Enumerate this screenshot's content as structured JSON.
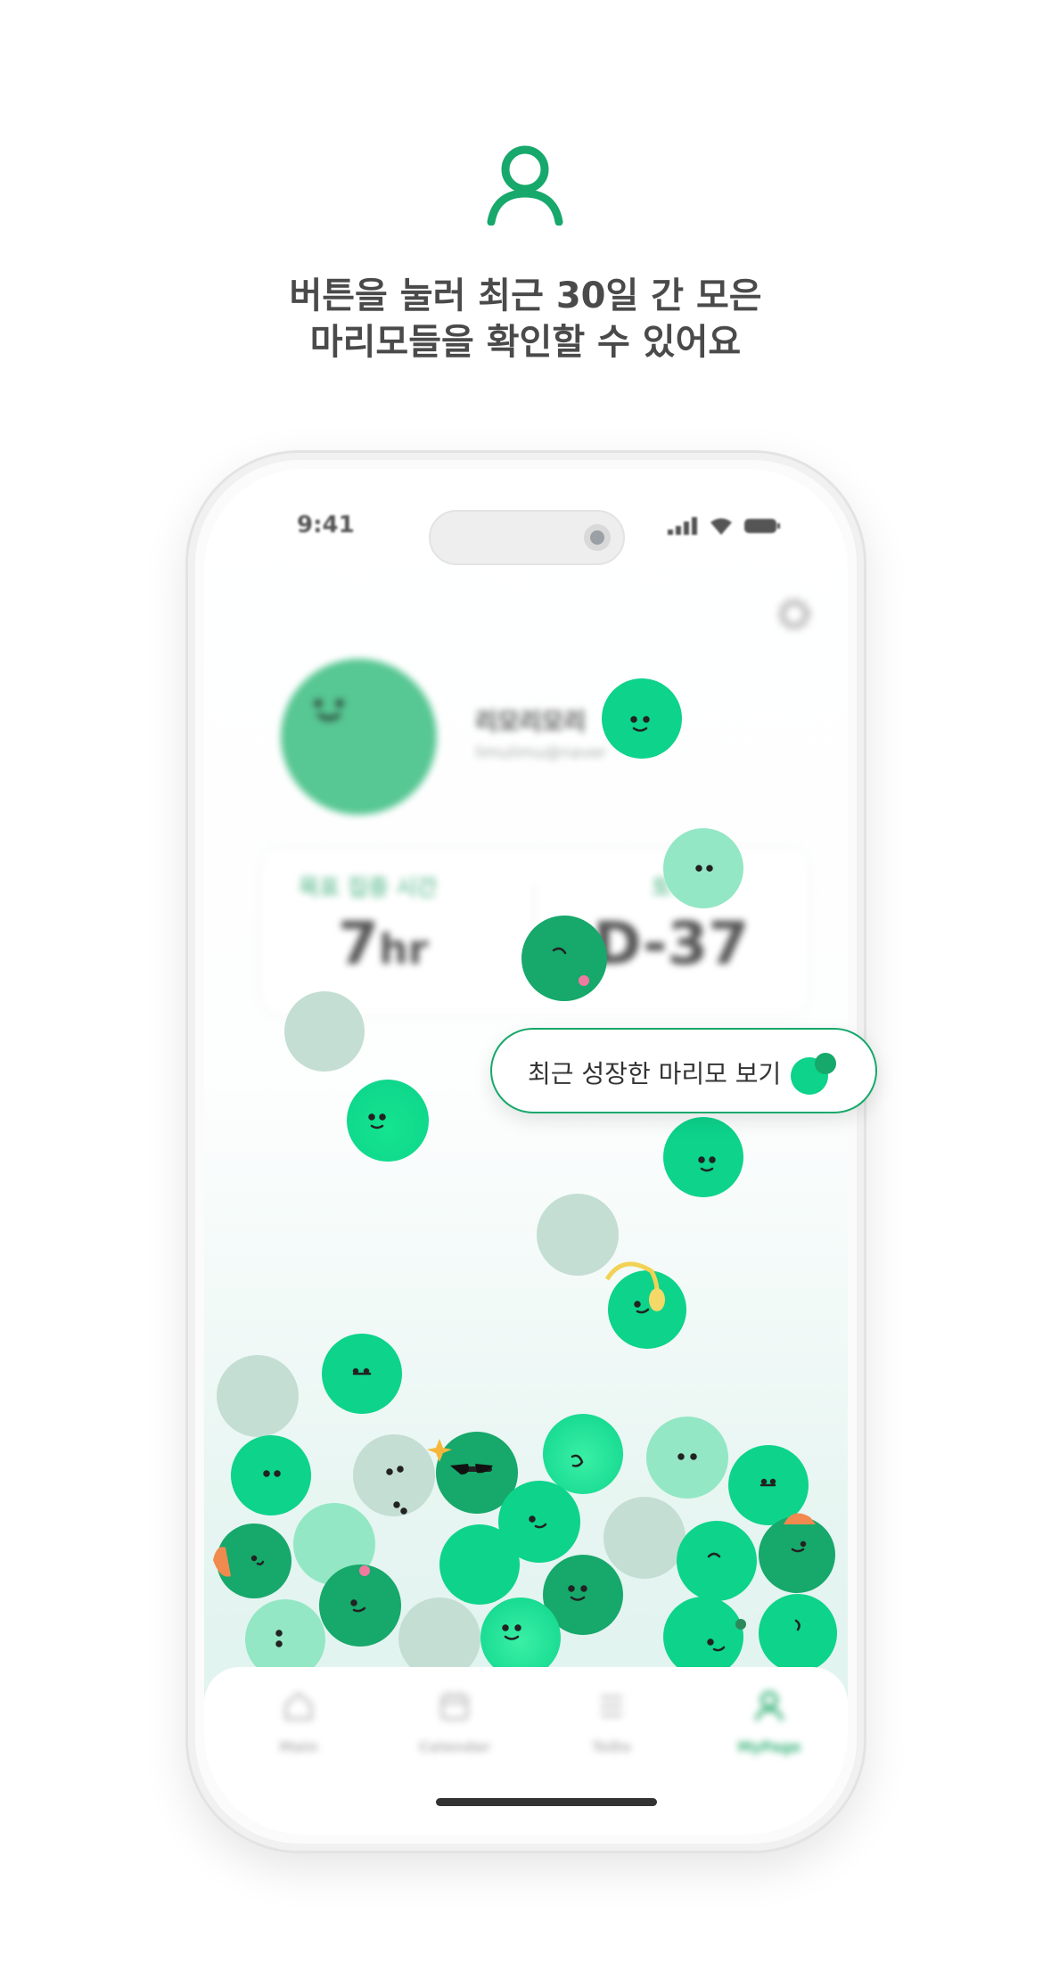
{
  "caption": {
    "line1": "버튼을 눌러 최근 30일 간 모은",
    "line2": "마리모들을 확인할 수 있어요"
  },
  "status": {
    "time": "9:41"
  },
  "profile": {
    "name": "리모리모리",
    "email": "limulimu@naver"
  },
  "stats": {
    "focus_label": "목표 집중 시간",
    "focus_value": "7",
    "focus_unit": "hr",
    "dday_label": "토익",
    "dday_value": "D-37"
  },
  "popup": {
    "label": "최근 성장한 마리모 보기"
  },
  "tabs": [
    {
      "label": "Main",
      "icon": "home-icon"
    },
    {
      "label": "Calendar",
      "icon": "calendar-icon"
    },
    {
      "label": "ToDo",
      "icon": "list-icon"
    },
    {
      "label": "MyPage",
      "icon": "person-icon",
      "active": true
    }
  ],
  "colors": {
    "accent": "#17a86b",
    "marimo_dark": "#17a86b",
    "marimo": "#0dd38b",
    "marimo_light": "#93e7c4",
    "marimo_pale": "#c4ded3"
  }
}
